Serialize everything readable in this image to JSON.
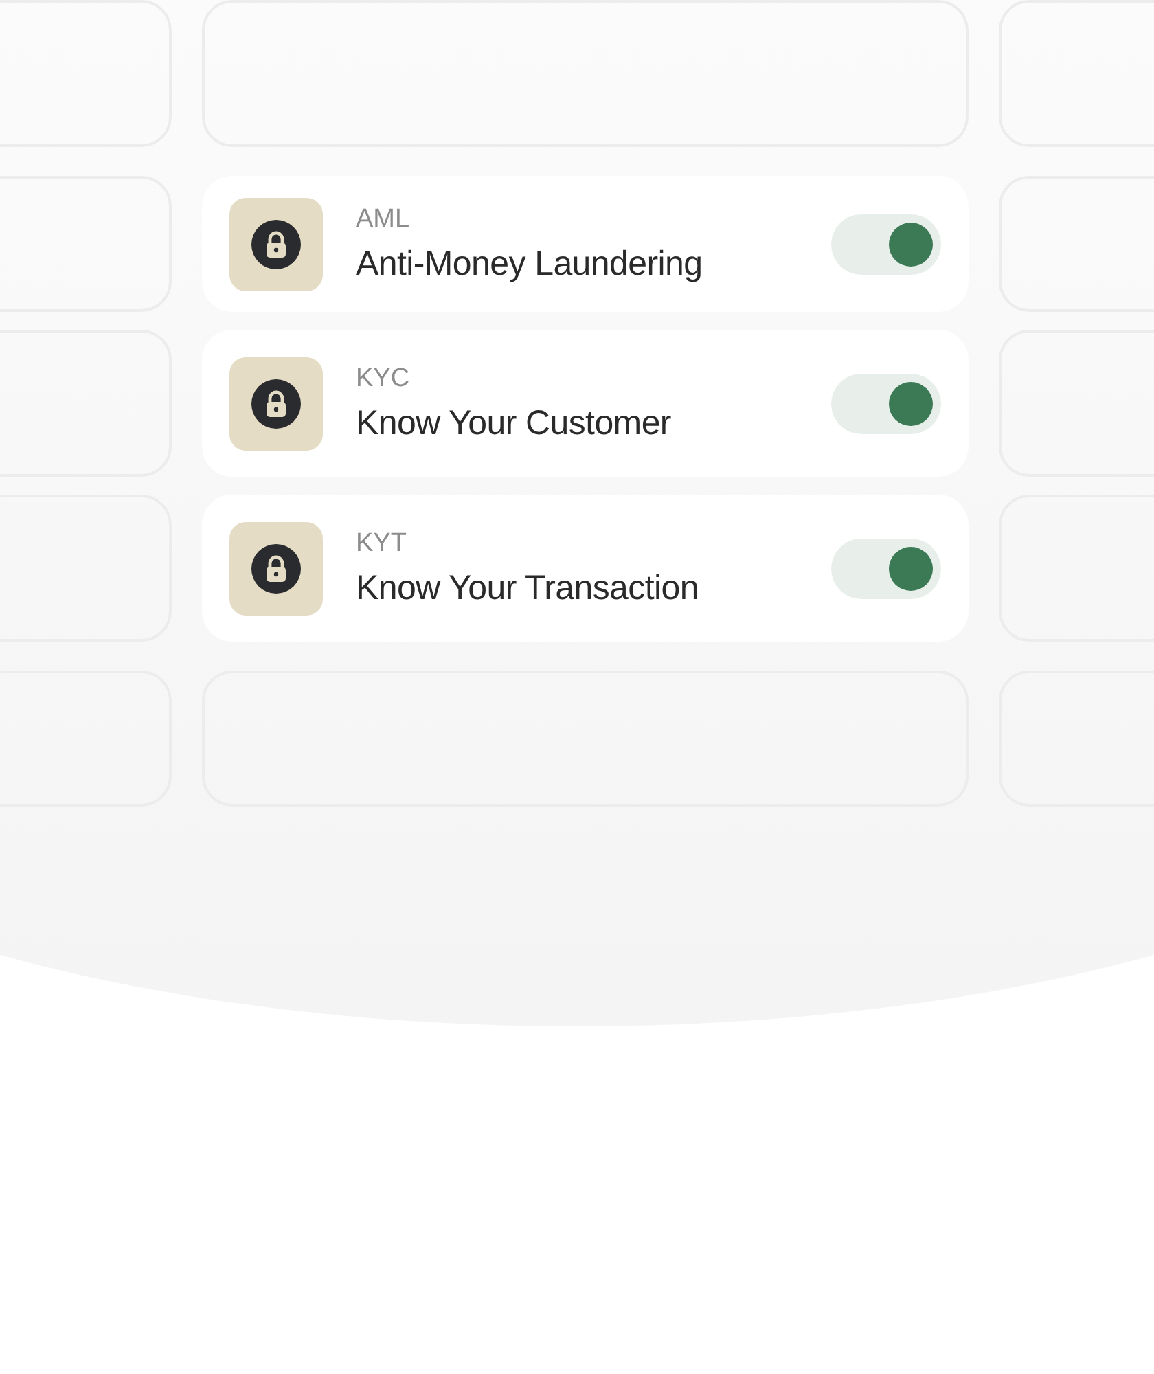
{
  "controls": [
    {
      "code": "AML",
      "name": "Anti-Money Laundering",
      "on": true
    },
    {
      "code": "KYC",
      "name": "Know Your Customer",
      "on": true
    },
    {
      "code": "KYT",
      "name": "Know Your Transaction",
      "on": true
    }
  ]
}
